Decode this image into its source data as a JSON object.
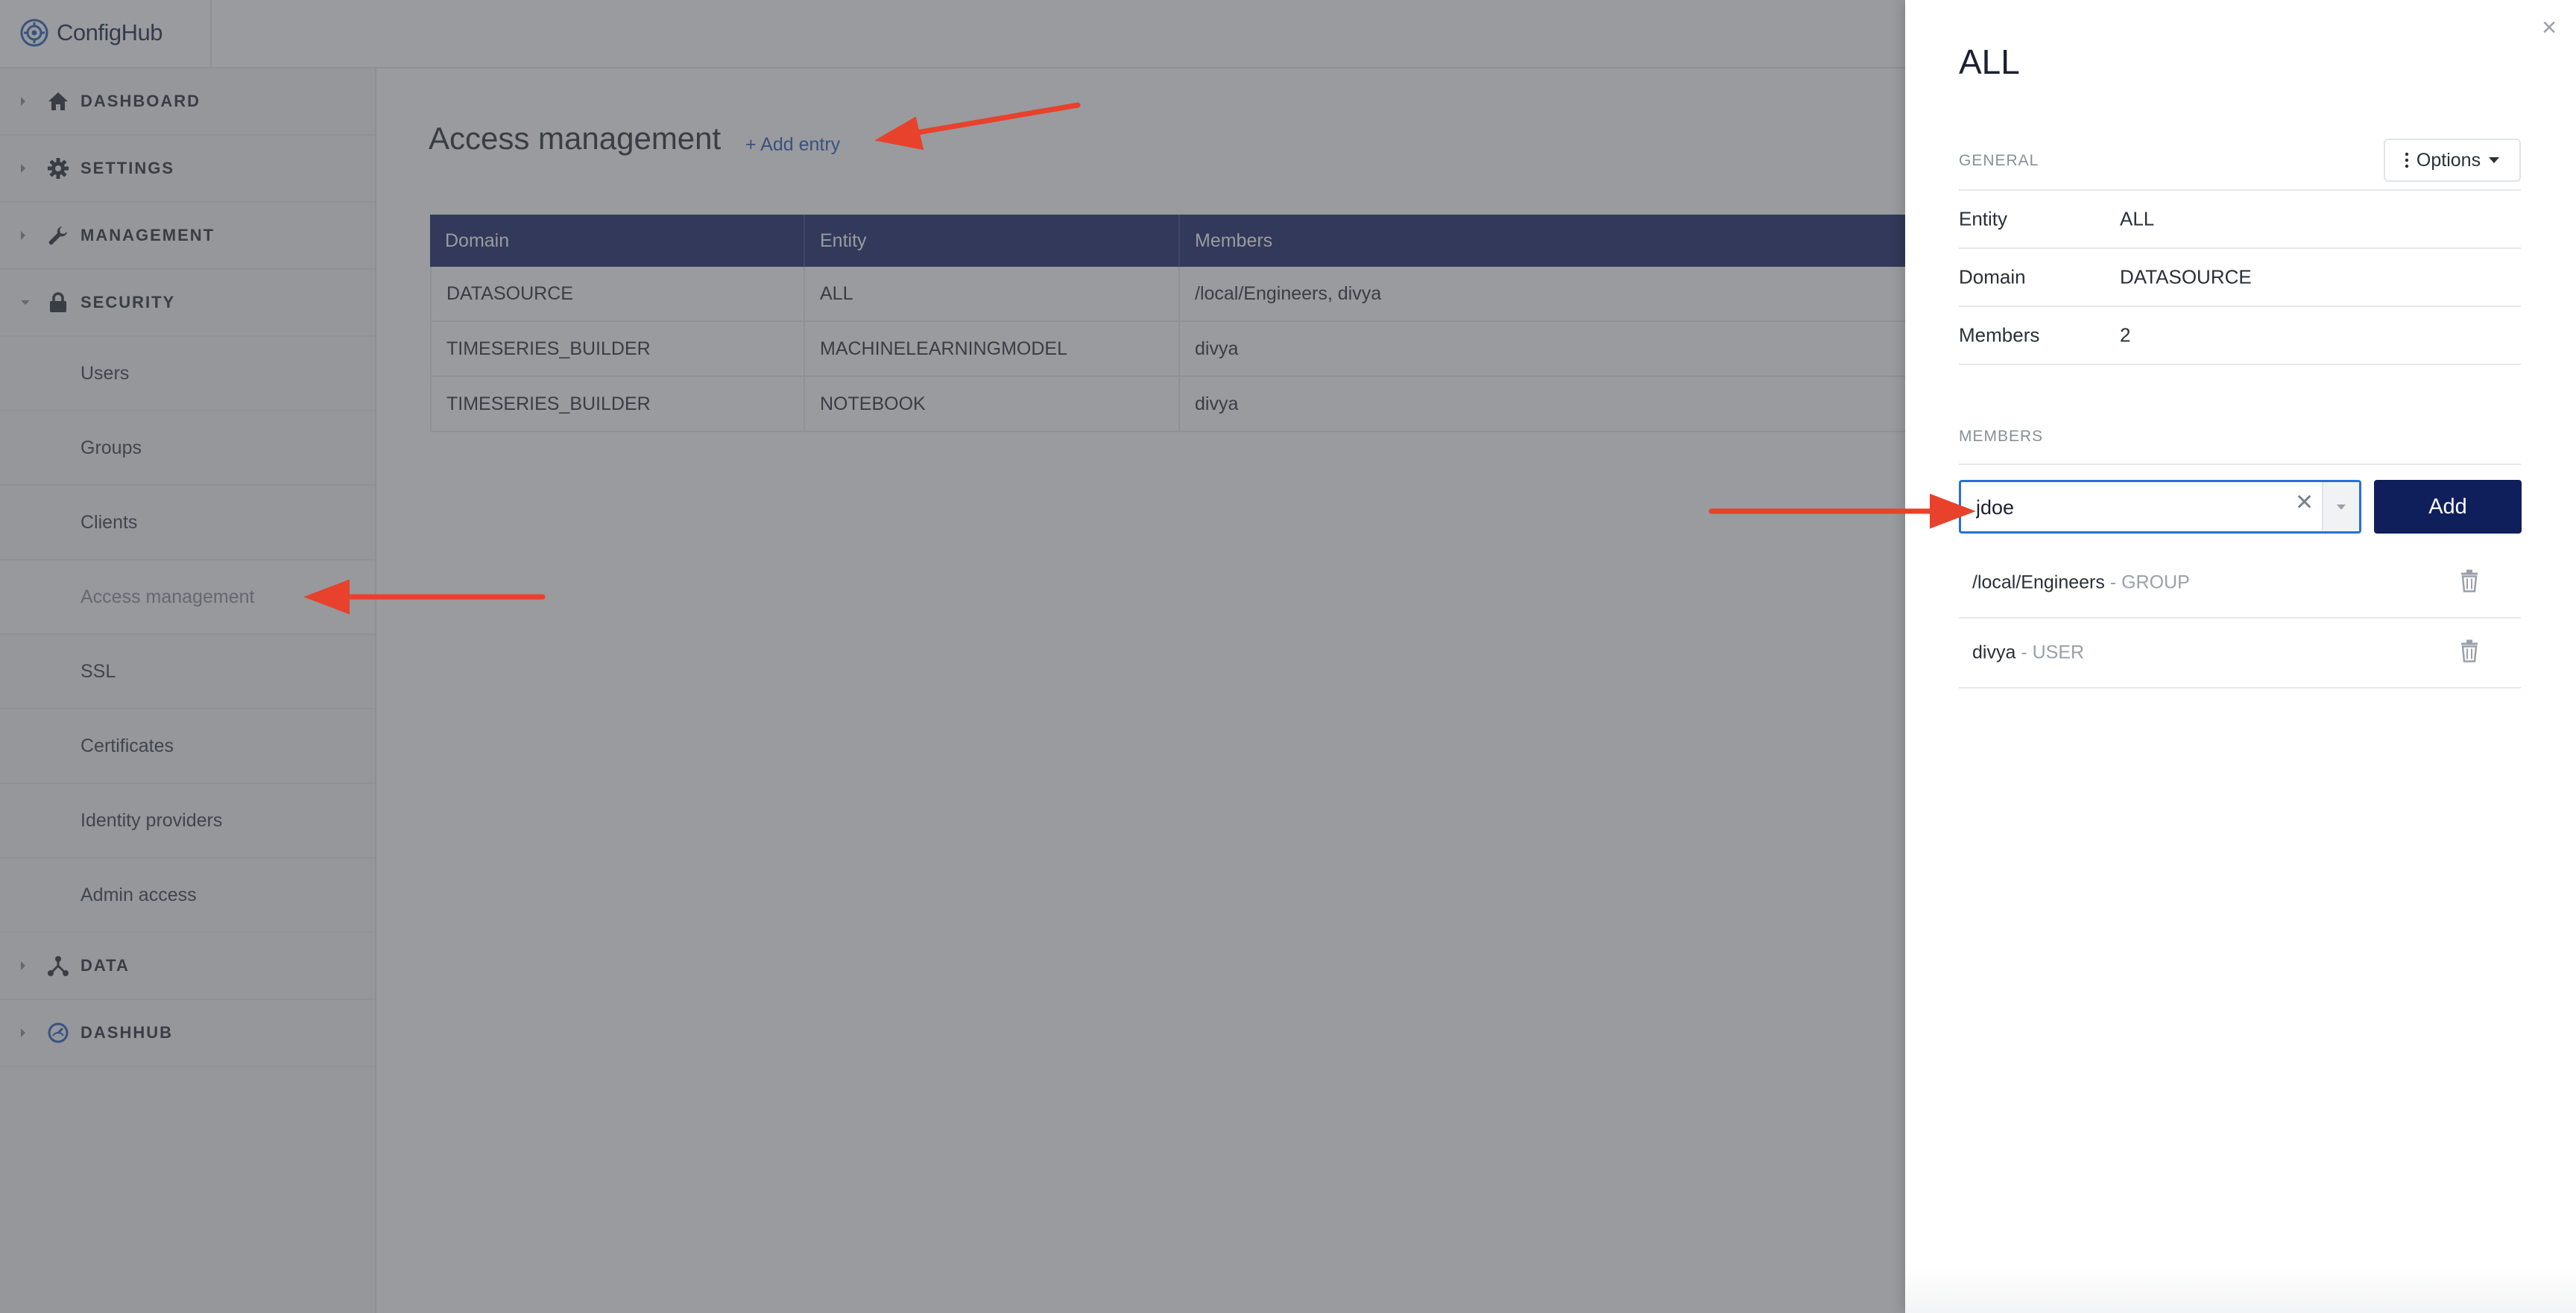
{
  "app": {
    "logo_text": "ConfigHub"
  },
  "sidebar": {
    "items": [
      {
        "label": "DASHBOARD",
        "icon": "home-icon"
      },
      {
        "label": "SETTINGS",
        "icon": "gear-icon"
      },
      {
        "label": "MANAGEMENT",
        "icon": "wrench-icon"
      },
      {
        "label": "SECURITY",
        "icon": "lock-icon"
      },
      {
        "label": "DATA",
        "icon": "network-icon"
      },
      {
        "label": "DASHHUB",
        "icon": "gauge-icon"
      }
    ],
    "security_subitems": [
      {
        "label": "Users"
      },
      {
        "label": "Groups"
      },
      {
        "label": "Clients"
      },
      {
        "label": "Access management"
      },
      {
        "label": "SSL"
      },
      {
        "label": "Certificates"
      },
      {
        "label": "Identity providers"
      },
      {
        "label": "Admin access"
      }
    ]
  },
  "main": {
    "title": "Access management",
    "add_entry_label": "+ Add entry",
    "table": {
      "headers": [
        "Domain",
        "Entity",
        "Members"
      ],
      "rows": [
        [
          "DATASOURCE",
          "ALL",
          "/local/Engineers, divya"
        ],
        [
          "TIMESERIES_BUILDER",
          "MACHINELEARNINGMODEL",
          "divya"
        ],
        [
          "TIMESERIES_BUILDER",
          "NOTEBOOK",
          "divya"
        ]
      ]
    }
  },
  "panel": {
    "title": "ALL",
    "general_label": "GENERAL",
    "options_label": "Options",
    "fields": [
      {
        "key": "Entity",
        "value": "ALL"
      },
      {
        "key": "Domain",
        "value": "DATASOURCE"
      },
      {
        "key": "Members",
        "value": "2"
      }
    ],
    "members_label": "MEMBERS",
    "member_input_value": "jdoe",
    "add_button_label": "Add",
    "members": [
      {
        "name": "/local/Engineers",
        "type": " - GROUP"
      },
      {
        "name": "divya",
        "type": " - USER"
      }
    ]
  },
  "colors": {
    "header_navy": "#1b2668",
    "add_button": "#0f1f5c",
    "annotation_arrow": "#e8412c",
    "link_blue": "#2d5cb4"
  }
}
